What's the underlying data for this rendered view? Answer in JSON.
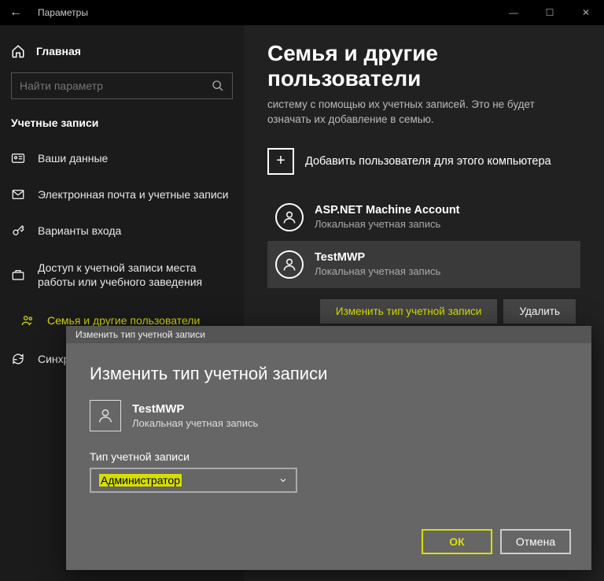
{
  "window": {
    "title": "Параметры",
    "min": "—",
    "max": "☐",
    "close": "✕"
  },
  "sidebar": {
    "home": "Главная",
    "search_placeholder": "Найти параметр",
    "section": "Учетные записи",
    "items": [
      {
        "label": "Ваши данные"
      },
      {
        "label": "Электронная почта и учетные записи"
      },
      {
        "label": "Варианты входа"
      },
      {
        "label": "Доступ к учетной записи места работы или учебного заведения"
      },
      {
        "label": "Семья и другие пользователи"
      },
      {
        "label": "Синхро"
      }
    ]
  },
  "content": {
    "heading": "Семья и другие пользователи",
    "desc": "систему с помощью их учетных записей. Это не будет означать их добавление в семью.",
    "add_user": "Добавить пользователя для этого компьютера",
    "users": [
      {
        "name": "ASP.NET Machine Account",
        "type": "Локальная учетная запись"
      },
      {
        "name": "TestMWP",
        "type": "Локальная учетная запись"
      }
    ],
    "actions": {
      "change_type": "Изменить тип учетной записи",
      "delete": "Удалить"
    }
  },
  "dialog": {
    "title": "Изменить тип учетной записи",
    "heading": "Изменить тип учетной записи",
    "user_name": "TestMWP",
    "user_type": "Локальная учетная запись",
    "field_label": "Тип учетной записи",
    "selected": "Администратор",
    "ok": "ОК",
    "cancel": "Отмена"
  }
}
